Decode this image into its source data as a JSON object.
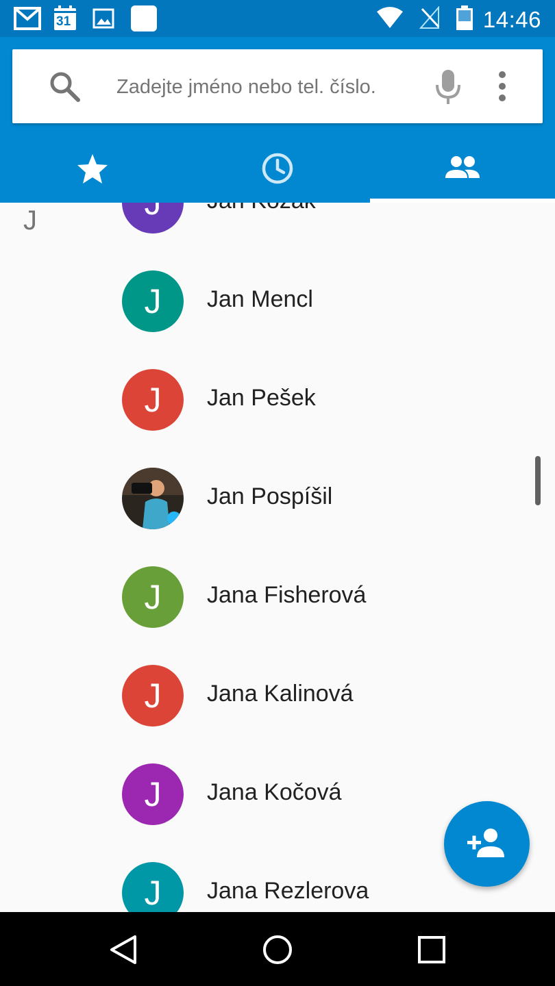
{
  "status_bar": {
    "time": "14:46",
    "calendar_day": "31",
    "notification_icons": [
      "gmail-icon",
      "calendar-icon",
      "gallery-icon",
      "blank-app-icon"
    ],
    "system_icons": [
      "wifi-icon",
      "no-signal-icon",
      "battery-icon"
    ]
  },
  "search": {
    "placeholder": "Zadejte jméno nebo tel. číslo."
  },
  "tabs": [
    {
      "name": "favorites",
      "icon": "star-icon"
    },
    {
      "name": "recents",
      "icon": "clock-icon"
    },
    {
      "name": "contacts",
      "icon": "people-icon",
      "selected": true
    }
  ],
  "contacts": {
    "section_letter": "J",
    "rows": [
      {
        "name": "Jan Kozák",
        "initial": "J",
        "color": "#673ab7"
      },
      {
        "name": "Jan Mencl",
        "initial": "J",
        "color": "#009688"
      },
      {
        "name": "Jan Pešek",
        "initial": "J",
        "color": "#db4437"
      },
      {
        "name": "Jan Pospíšil",
        "initial": "",
        "color": "#3a3a3a",
        "photo": true
      },
      {
        "name": "Jana Fisherová",
        "initial": "J",
        "color": "#689f38"
      },
      {
        "name": "Jana Kalinová",
        "initial": "J",
        "color": "#db4437"
      },
      {
        "name": "Jana Kočová",
        "initial": "J",
        "color": "#9c27b0"
      },
      {
        "name": "Jana Rezlerova",
        "initial": "J",
        "color": "#0097a7"
      }
    ]
  },
  "fab": {
    "icon": "add-person-icon"
  },
  "colors": {
    "status_bar": "#0277bd",
    "app_bar": "#0288d1",
    "list_background": "#fafafa"
  }
}
